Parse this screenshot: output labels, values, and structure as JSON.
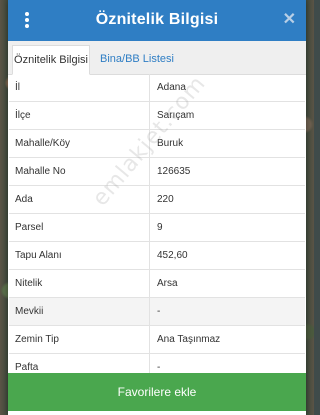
{
  "dialog": {
    "title": "Öznitelik Bilgisi",
    "close_glyph": "✕"
  },
  "tabs": [
    {
      "label": "Öznitelik Bilgisi",
      "active": true
    },
    {
      "label": "Bina/BB Listesi",
      "active": false
    }
  ],
  "attributes": [
    {
      "key": "İl",
      "value": "Adana"
    },
    {
      "key": "İlçe",
      "value": "Sarıçam"
    },
    {
      "key": "Mahalle/Köy",
      "value": "Buruk"
    },
    {
      "key": "Mahalle No",
      "value": "126635"
    },
    {
      "key": "Ada",
      "value": "220"
    },
    {
      "key": "Parsel",
      "value": "9"
    },
    {
      "key": "Tapu Alanı",
      "value": "452,60"
    },
    {
      "key": "Nitelik",
      "value": "Arsa"
    },
    {
      "key": "Mevkii",
      "value": "-"
    },
    {
      "key": "Zemin Tip",
      "value": "Ana Taşınmaz"
    },
    {
      "key": "Pafta",
      "value": "-"
    }
  ],
  "watermark": "emlakjet.com",
  "actions": {
    "favorite_label": "Favorilere ekle"
  },
  "colors": {
    "header": "#2f7ec4",
    "button": "#4aa74e",
    "tab_link": "#2f7ec4"
  },
  "icons": {
    "menu": "more-vertical-icon",
    "close": "close-icon"
  }
}
